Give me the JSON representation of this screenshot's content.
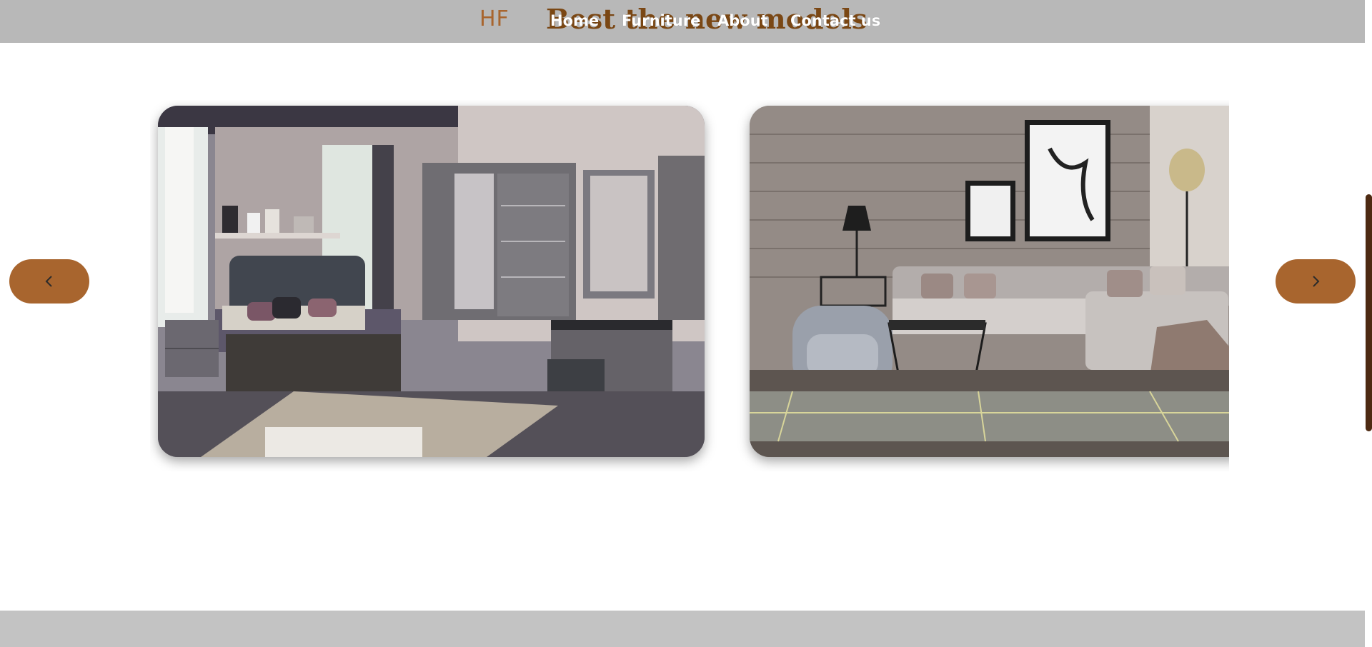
{
  "header": {
    "logo": "HF",
    "section_title": "Best the new models",
    "nav": [
      {
        "label": "Home"
      },
      {
        "label": "Furniture"
      },
      {
        "label": "About"
      },
      {
        "label": "Contact us"
      }
    ]
  },
  "carousel": {
    "slides": [
      {
        "subject": "bedroom furniture set with grey bed, wardrobe and dresser"
      },
      {
        "subject": "living room with sectional sofa, armchair and glass coffee table"
      }
    ],
    "prev_icon": "chevron-left-icon",
    "next_icon": "chevron-right-icon"
  },
  "colors": {
    "header_bg": "#b8b8b8",
    "accent": "#a8652e",
    "title": "#7a4714",
    "footer_bg": "#c3c3c3",
    "scrollbar": "#4d2a12"
  }
}
